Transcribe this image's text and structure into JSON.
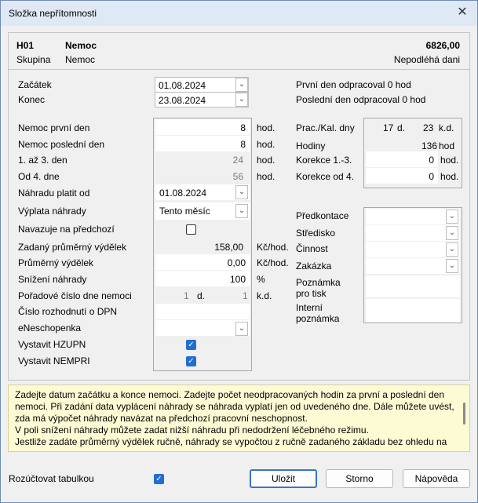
{
  "window": {
    "title": "Složka nepřítomnosti",
    "close": "✕"
  },
  "header": {
    "code": "H01",
    "name": "Nemoc",
    "amount": "6826,00",
    "group_label": "Skupina",
    "group_value": "Nemoc",
    "tax_note": "Nepodléhá dani"
  },
  "dates": {
    "start_label": "Začátek",
    "start_value": "01.08.2024",
    "end_label": "Konec",
    "end_value": "23.08.2024",
    "first_day_note": "První den odpracoval 0 hod",
    "last_day_note": "Poslední den odpracoval 0 hod"
  },
  "left": {
    "first_day_label": "Nemoc první den",
    "first_day_value": "8",
    "first_day_unit": "hod.",
    "last_day_label": "Nemoc poslední den",
    "last_day_value": "8",
    "last_day_unit": "hod.",
    "days13_label": "1. až 3. den",
    "days13_value": "24",
    "days13_unit": "hod.",
    "days4_label": "Od 4. dne",
    "days4_value": "56",
    "days4_unit": "hod.",
    "pay_from_label": "Náhradu platit od",
    "pay_from_value": "01.08.2024",
    "payout_label": "Výplata náhrady",
    "payout_value": "Tento měsíc",
    "continues_label": "Navazuje na předchozí",
    "avg_entered_label": "Zadaný průměrný výdělek",
    "avg_entered_value": "158,00",
    "avg_entered_unit": "Kč/hod.",
    "avg_label": "Průměrný výdělek",
    "avg_value": "0,00",
    "avg_unit": "Kč/hod.",
    "reduction_label": "Snížení náhrady",
    "reduction_value": "100",
    "reduction_unit": "%",
    "seq_label": "Pořadové číslo dne nemoci",
    "seq_value1": "1",
    "seq_unit1": "d.",
    "seq_value2": "1",
    "seq_unit2": "k.d.",
    "dpn_label": "Číslo rozhodnutí o DPN",
    "eneschop_label": "eNeschopenka",
    "hzupn_label": "Vystavit HZUPN",
    "nempri_label": "Vystavit NEMPRI"
  },
  "right": {
    "prac_label": "Prac./Kal. dny",
    "prac_value": "17",
    "prac_unit": "d.",
    "kal_value": "23",
    "kal_unit": "k.d.",
    "hours_label": "Hodiny",
    "hours_value": "136",
    "hours_unit": "hod",
    "corr13_label": "Korekce 1.-3.",
    "corr13_value": "0",
    "corr13_unit": "hod.",
    "corr4_label": "Korekce od 4.",
    "corr4_value": "0",
    "corr4_unit": "hod.",
    "predkontace_label": "Předkontace",
    "stredisko_label": "Středisko",
    "cinnost_label": "Činnost",
    "zakazka_label": "Zakázka",
    "print_note_label1": "Poznámka",
    "print_note_label2": "pro tisk",
    "internal_note_label1": "Interní",
    "internal_note_label2": "poznámka"
  },
  "help": {
    "line1": "Zadejte datum začátku a konce nemoci. Zadejte počet neodpracovaných hodin za první a poslední den",
    "line2": "nemoci. Při zadání data vyplácení náhrady se náhrada vyplatí jen od uvedeného dne. Dále můžete uvést,",
    "line3": "zda má výpočet náhrady navázat na předchozí pracovní neschopnost.",
    "line4": "V poli snížení náhrady můžete zadat nižší náhradu při nedodržení léčebného režimu.",
    "line5": "Jestliže zadáte průměrný výdělek ručně, náhrady se vypočtou z ručně zadaného základu bez ohledu na"
  },
  "footer": {
    "rozuctovat_label": "Rozúčtovat tabulkou",
    "ok": "Uložit",
    "cancel": "Storno",
    "help": "Nápověda"
  }
}
